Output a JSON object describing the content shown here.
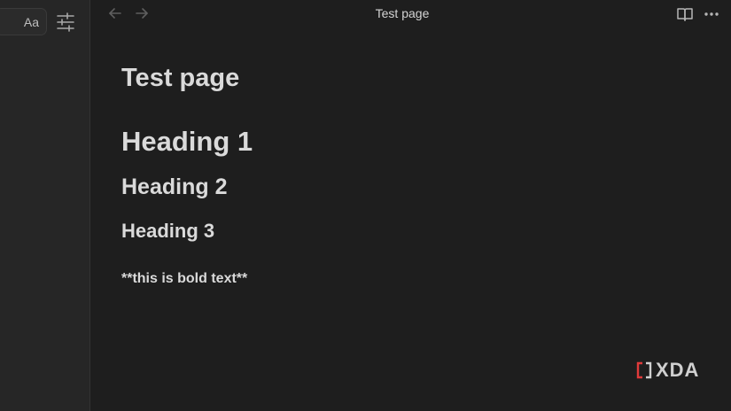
{
  "sidebar": {
    "font_button_label": "Aa",
    "settings_icon": "sliders-icon"
  },
  "topbar": {
    "back_icon": "arrow-left-icon",
    "forward_icon": "arrow-right-icon",
    "title": "Test page",
    "reader_icon": "book-open-icon",
    "more_icon": "more-horizontal-icon"
  },
  "document": {
    "title": "Test page",
    "heading1": "Heading 1",
    "heading2": "Heading 2",
    "heading3": "Heading 3",
    "paragraph": "**this is bold text**"
  },
  "watermark": {
    "text": "XDA",
    "accent_color": "#e03a3a"
  },
  "colors": {
    "background": "#1e1e1e",
    "sidebar": "#262626",
    "text": "#dadada",
    "muted_icon": "#8a8a8a"
  }
}
